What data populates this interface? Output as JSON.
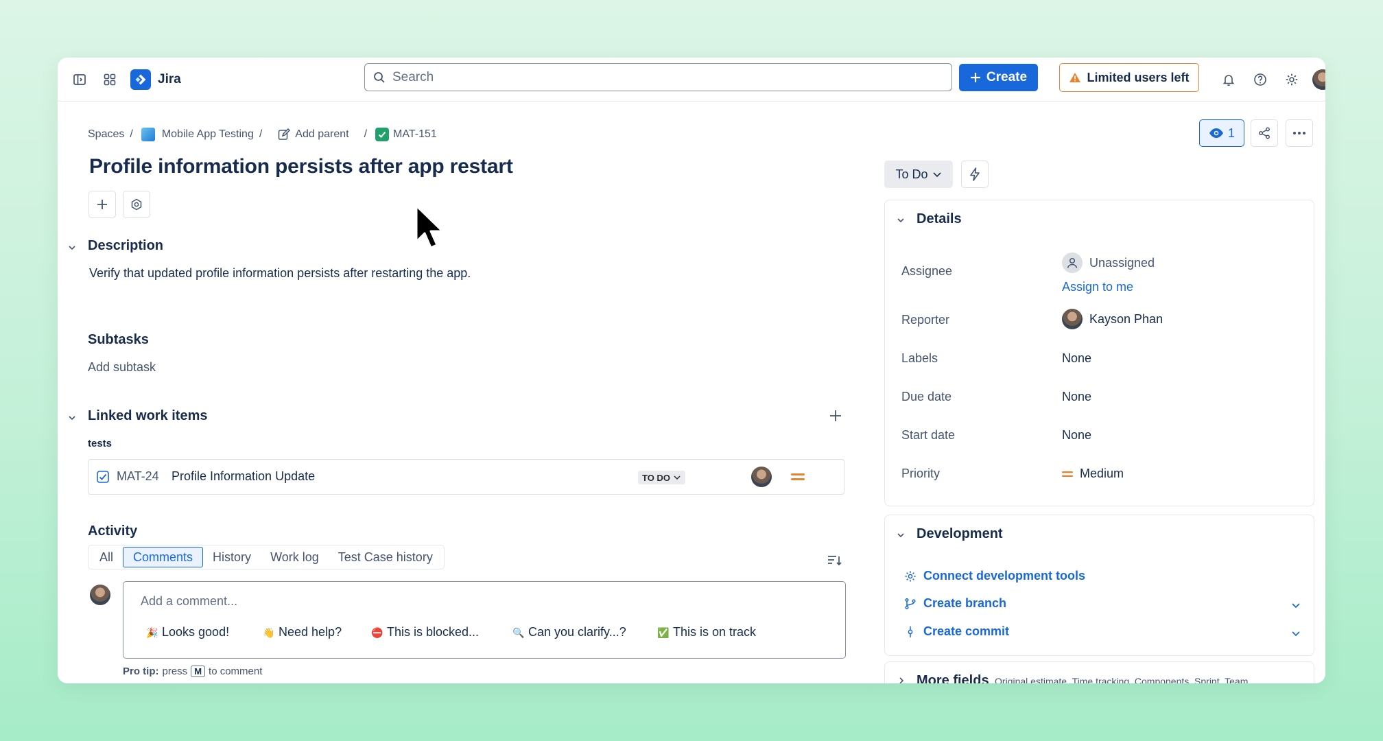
{
  "topbar": {
    "app_name": "Jira",
    "search_placeholder": "Search",
    "create_label": "Create",
    "limited_label": "Limited users left"
  },
  "breadcrumb": {
    "spaces": "Spaces",
    "project": "Mobile App Testing",
    "add_parent": "Add parent",
    "issue_key": "MAT-151"
  },
  "issue": {
    "title": "Profile information persists after app restart",
    "status": "To Do",
    "watchers": "1"
  },
  "description": {
    "heading": "Description",
    "text": "Verify that updated profile information persists after restarting the app."
  },
  "subtasks": {
    "heading": "Subtasks",
    "add_label": "Add subtask"
  },
  "linked": {
    "heading": "Linked work items",
    "relation": "tests",
    "item": {
      "key": "MAT-24",
      "summary": "Profile Information Update",
      "status": "TO DO"
    }
  },
  "activity": {
    "heading": "Activity",
    "tabs": [
      "All",
      "Comments",
      "History",
      "Work log",
      "Test Case history"
    ],
    "active_tab": "Comments",
    "comment_placeholder": "Add a comment...",
    "quick_replies": [
      {
        "emoji": "🎉",
        "label": "Looks good!"
      },
      {
        "emoji": "👋",
        "label": "Need help?"
      },
      {
        "emoji": "⛔",
        "label": "This is blocked..."
      },
      {
        "emoji": "🔍",
        "label": "Can you clarify...?"
      },
      {
        "emoji": "✅",
        "label": "This is on track"
      }
    ],
    "pro_tip_bold": "Pro tip:",
    "pro_tip_press": "press",
    "pro_tip_key": "M",
    "pro_tip_rest": "to comment"
  },
  "details": {
    "heading": "Details",
    "assignee_label": "Assignee",
    "assignee_value": "Unassigned",
    "assign_to_me": "Assign to me",
    "reporter_label": "Reporter",
    "reporter_value": "Kayson Phan",
    "labels_label": "Labels",
    "labels_value": "None",
    "due_label": "Due date",
    "due_value": "None",
    "start_label": "Start date",
    "start_value": "None",
    "priority_label": "Priority",
    "priority_value": "Medium"
  },
  "development": {
    "heading": "Development",
    "connect": "Connect development tools",
    "branch": "Create branch",
    "commit": "Create commit"
  },
  "more_fields": {
    "heading": "More fields",
    "summary": "Original estimate, Time tracking, Components, Sprint, Team"
  },
  "colors": {
    "brand": "#1868db",
    "warning": "#e2852e",
    "priority": "#e2852e"
  }
}
